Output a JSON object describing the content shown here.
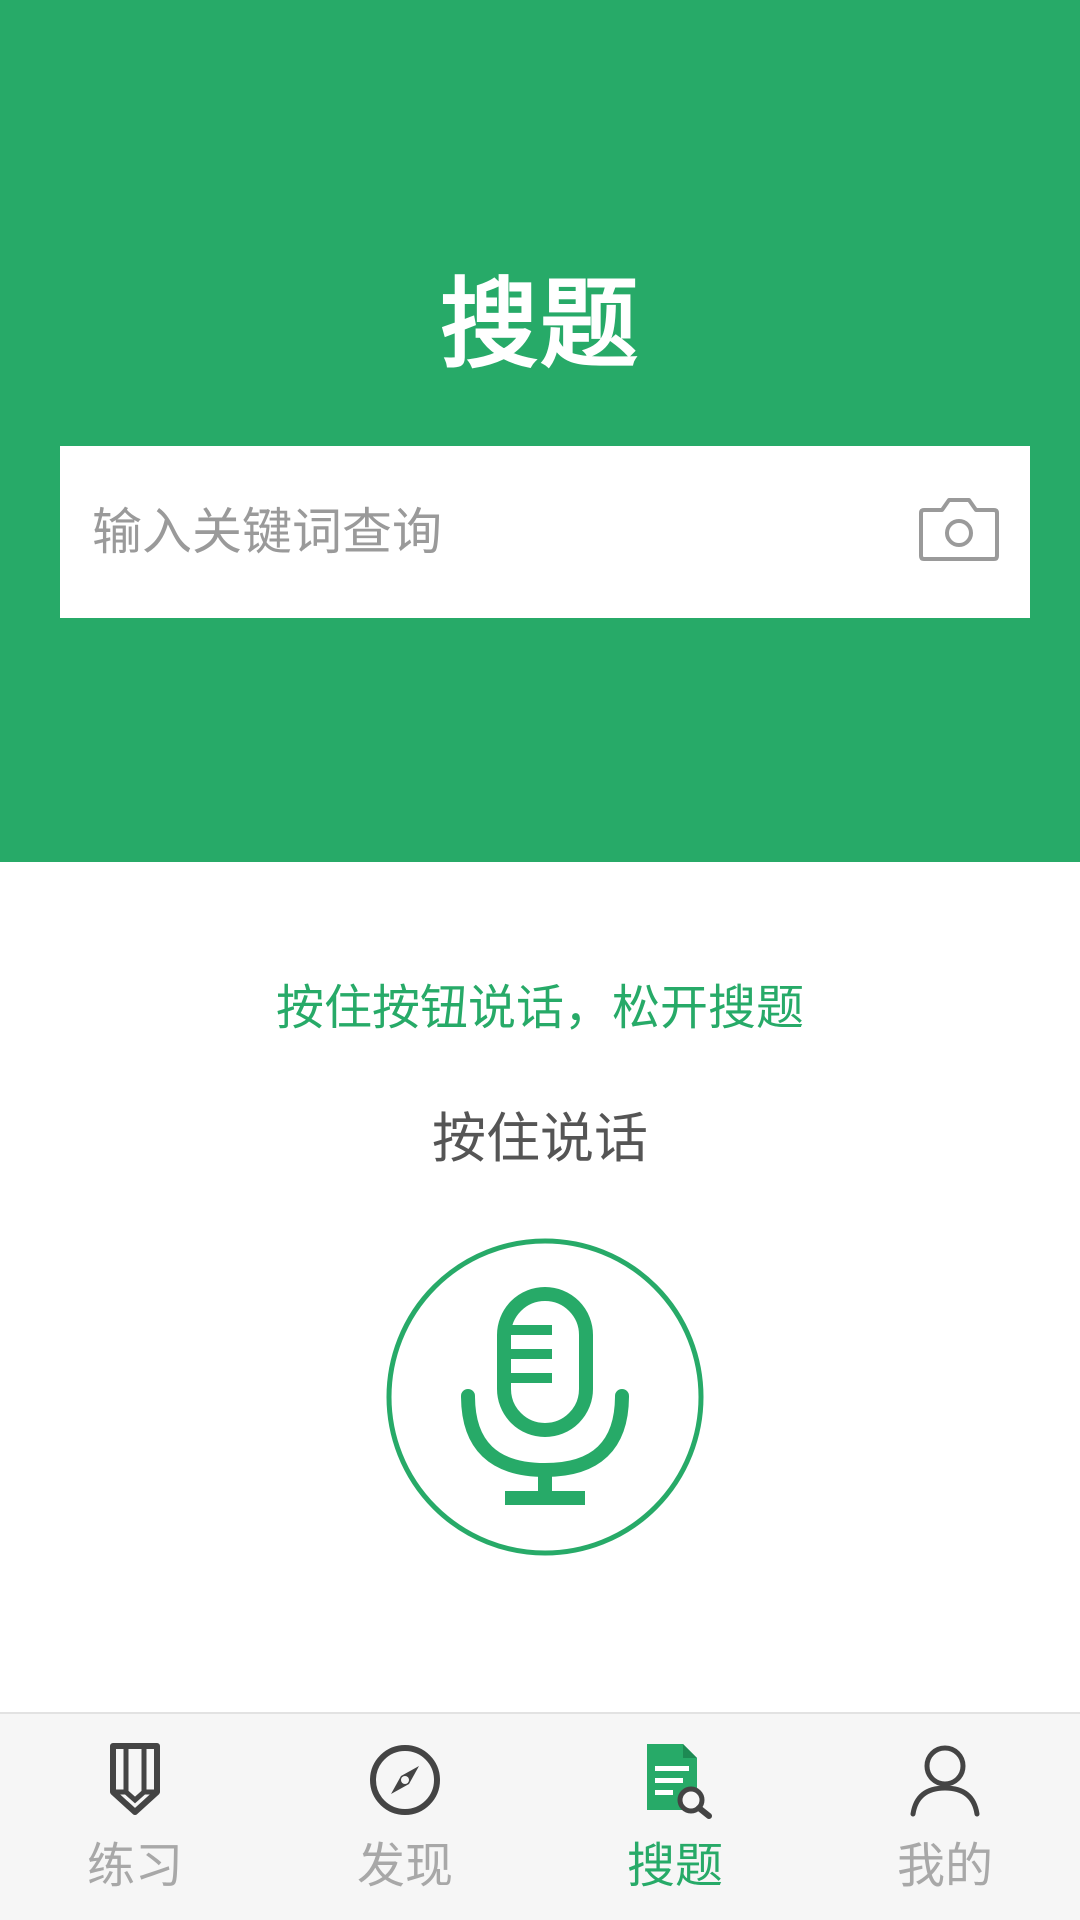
{
  "header": {
    "title": "搜题"
  },
  "search": {
    "placeholder": "输入关键词查询",
    "value": ""
  },
  "voice": {
    "hint": "按住按钮说话，松开搜题",
    "hold_label": "按住说话"
  },
  "nav": {
    "items": [
      {
        "label": "练习",
        "icon": "pencil-icon",
        "active": false
      },
      {
        "label": "发现",
        "icon": "compass-icon",
        "active": false
      },
      {
        "label": "搜题",
        "icon": "search-document-icon",
        "active": true
      },
      {
        "label": "我的",
        "icon": "user-icon",
        "active": false
      }
    ]
  },
  "colors": {
    "accent": "#27aa68",
    "inactive": "#a8a8a8",
    "nav_background": "#f6f6f6"
  }
}
